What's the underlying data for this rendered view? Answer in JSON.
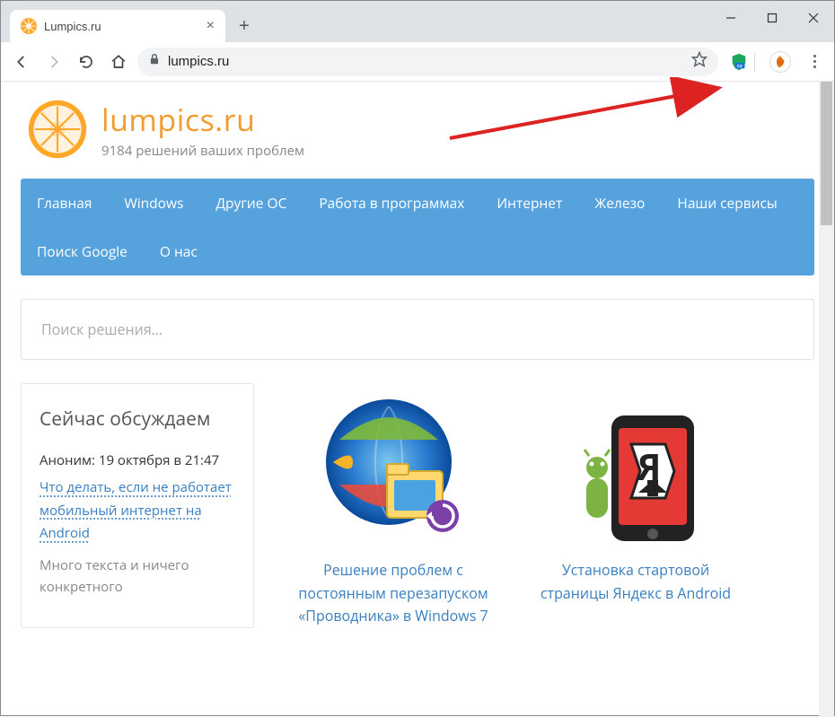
{
  "tab": {
    "title": "Lumpics.ru"
  },
  "address": {
    "url": "lumpics.ru"
  },
  "extensions": {
    "ext1_badge": "cz"
  },
  "site": {
    "title": "lumpics.ru",
    "subtitle": "9184 решений ваших проблем"
  },
  "nav": {
    "items": [
      "Главная",
      "Windows",
      "Другие ОС",
      "Работа в программах",
      "Интернет",
      "Железо",
      "Наши сервисы",
      "Поиск Google",
      "О нас"
    ]
  },
  "search": {
    "placeholder": "Поиск решения…"
  },
  "sidebar": {
    "title": "Сейчас обсуждаем",
    "author": "Аноним",
    "timestamp": ": 19 октября в 21:47",
    "link": "Что делать, если не работает мобильный интернет на Android",
    "excerpt": "Много текста и ничего конкретного"
  },
  "articles": [
    {
      "title": "Решение проблем с постоянным перезапуском «Проводника» в Windows 7"
    },
    {
      "title": "Установка стартовой страницы Яндекс в Android"
    }
  ]
}
